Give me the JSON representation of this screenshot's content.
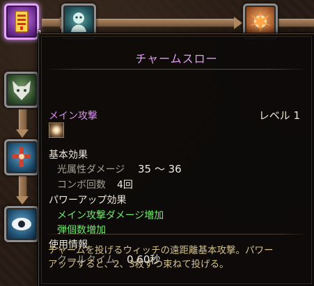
{
  "skill_tree": {
    "selected_node_level": "1"
  },
  "tooltip": {
    "title": "チャームスロー",
    "attack_type": "メイン攻撃",
    "level_label": "レベル 1",
    "base_effect_header": "基本効果",
    "stats": [
      {
        "label": "光属性ダメージ",
        "value": "35 ～ 36"
      },
      {
        "label": "コンボ回数",
        "value": "4回"
      }
    ],
    "powerup_header": "パワーアップ効果",
    "powerups": [
      "メイン攻撃ダメージ増加",
      "弾個数増加"
    ],
    "usage_header": "使用情報",
    "cooldown_label": "クールタイム",
    "cooldown_value": "0.60秒",
    "description_line1": "チャームを投げるウィッチの遠距離基本攻撃。パワー",
    "description_line2": "アップすると、2、3枚ずつ束ねて投げる。"
  },
  "colors": {
    "title": "#e39bf2",
    "powerup": "#6fe86a",
    "description": "#d2c08a"
  }
}
